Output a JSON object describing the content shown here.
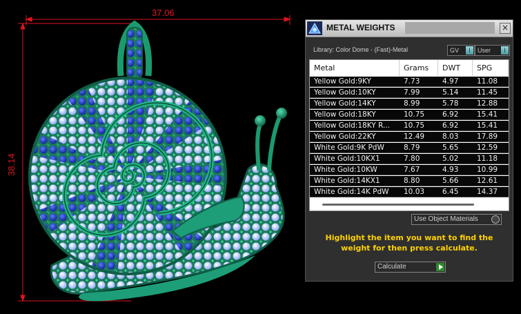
{
  "viewport": {
    "dim_width": "37.06",
    "dim_height": "38.14"
  },
  "panel": {
    "title": "METAL WEIGHTS",
    "close_label": "×",
    "library": "Library: Color Dome - (Fast)-Metal",
    "toggle_gv": "GV",
    "toggle_user": "User",
    "table": {
      "headers": [
        "Metal",
        "Grams",
        "DWT",
        "SPG"
      ],
      "rows": [
        [
          "Yellow Gold:9KY",
          "7.73",
          "4.97",
          "11.08"
        ],
        [
          "Yellow Gold:10KY",
          "7.99",
          "5.14",
          "11.45"
        ],
        [
          "Yellow Gold:14KY",
          "8.99",
          "5.78",
          "12.88"
        ],
        [
          "Yellow Gold:18KY",
          "10.75",
          "6.92",
          "15.41"
        ],
        [
          "Yellow Gold:18KY R...",
          "10.75",
          "6.92",
          "15.41"
        ],
        [
          "Yellow Gold:22KY",
          "12.49",
          "8.03",
          "17.89"
        ],
        [
          "White Gold:9K PdW",
          "8.79",
          "5.65",
          "12.59"
        ],
        [
          "White Gold:10KX1",
          "7.80",
          "5.02",
          "11.18"
        ],
        [
          "White Gold:10KW",
          "7.67",
          "4.93",
          "10.99"
        ],
        [
          "White Gold:14KX1",
          "8.80",
          "5.66",
          "12.61"
        ],
        [
          "White Gold:14K PdW",
          "10.03",
          "6.45",
          "14.37"
        ]
      ]
    },
    "use_materials_label": "Use Object Materials",
    "instructions": "Highlight the item you want to find the weight for then press calculate.",
    "calculate_label": "Calculate"
  },
  "colors": {
    "jewel_green": "#1f8f6a",
    "jewel_blue": "#1c3cb4",
    "jewel_light": "#c8d8ff",
    "dimension_red": "#e0141e",
    "instruction_yellow": "#ffd200"
  }
}
